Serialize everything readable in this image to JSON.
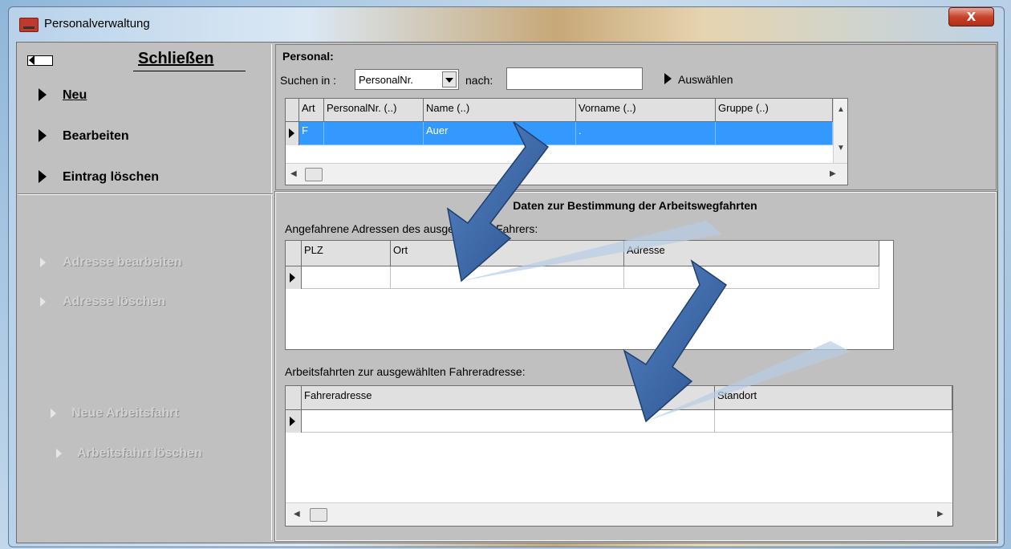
{
  "window": {
    "title": "Personalverwaltung",
    "close_glyph": "X"
  },
  "left_menu": {
    "close_label": "Schließen",
    "items": [
      {
        "label": "Neu",
        "enabled": true
      },
      {
        "label": "Bearbeiten",
        "enabled": true
      },
      {
        "label": "Eintrag löschen",
        "enabled": true
      }
    ],
    "address_actions": [
      {
        "label": "Adresse bearbeiten",
        "enabled": false
      },
      {
        "label": "Adresse löschen",
        "enabled": false
      }
    ],
    "trip_actions": [
      {
        "label": "Neue Arbeitsfahrt",
        "enabled": false
      },
      {
        "label": "Arbeitsfahrt löschen",
        "enabled": false
      }
    ]
  },
  "personal": {
    "heading": "Personal:",
    "search_in_label": "Suchen in :",
    "search_in_value": "PersonalNr.",
    "search_for_label": "nach:",
    "search_for_value": "",
    "select_label": "Auswählen",
    "grid": {
      "columns": [
        "Art",
        "PersonalNr. (..)",
        "Name (..)",
        "Vorname (..)",
        "Gruppe (..)"
      ],
      "rows": [
        {
          "art": "F",
          "personalnr": "",
          "name": "Auer",
          "vorname": ".",
          "gruppe": ""
        }
      ]
    }
  },
  "details": {
    "heading": "Daten zur Bestimmung der Arbeitswegfahrten",
    "addresses_label": "Angefahrene Adressen des ausgewählten Fahrers:",
    "addresses_grid": {
      "columns": [
        "PLZ",
        "Ort",
        "Adresse"
      ]
    },
    "trips_label": "Arbeitsfahrten zur ausgewählten Fahreradresse:",
    "trips_grid": {
      "columns": [
        "Fahreradresse",
        "Standort"
      ]
    }
  },
  "colors": {
    "selection": "#3399ff",
    "arrow": "#3f6fb0",
    "panel_bg": "#c0c0c0"
  }
}
